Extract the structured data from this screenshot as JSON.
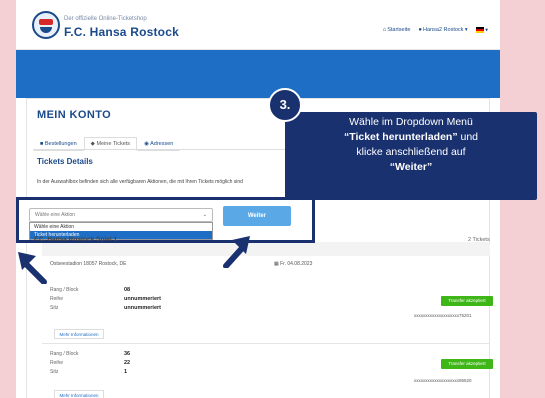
{
  "header": {
    "brand_sub": "Der offizielle Online-Ticketshop",
    "brand_main": "F.C. Hansa Rostock",
    "nav_home": "Startseite",
    "nav_user": "Hansa2 Rostock ▾",
    "nav_lang": "▾"
  },
  "account": {
    "title": "MEIN KONTO",
    "tabs": [
      {
        "label": "Bestellungen"
      },
      {
        "label": "Meine Tickets"
      },
      {
        "label": "Adressen"
      }
    ],
    "tickets_heading": "Tickets Details",
    "intro": "In der Auswahlbox befinden sich alle verfügbaren Aktionen, die mit Ihren Tickets möglich sind"
  },
  "dropdown": {
    "placeholder": "Wähle eine Aktion",
    "options": [
      "Wähle eine Aktion",
      "Ticket herunterladen"
    ],
    "selected": "Ticket herunterladen",
    "button": "Weiter"
  },
  "event": {
    "name": "F.C. Hansa Rostock Spiel 1",
    "ticket_count": "2 Tickets",
    "venue": "Ostseestadion 18057 Rostock, DE",
    "date": "Fr. 04.08.2023"
  },
  "tickets": [
    {
      "labels": [
        "Rang / Block",
        "Reihe",
        "Sitz"
      ],
      "values": [
        "08",
        "unnummeriert",
        "unnummeriert"
      ],
      "transfer": "Transfer akzeptiert",
      "barcode": "xxxxxxxxxxxxxxxxxxxx75201",
      "more": "Mehr Informationen"
    },
    {
      "labels": [
        "Rang / Block",
        "Reihe",
        "Sitz"
      ],
      "values": [
        "36",
        "22",
        "1"
      ],
      "transfer": "Transfer akzeptiert",
      "barcode": "xxxxxxxxxxxxxxxxxxxx95520",
      "more": "Mehr Informationen"
    }
  ],
  "callout": {
    "step": "3.",
    "line1": "Wähle im Dropdown Menü",
    "line2_bold": "“Ticket herunterladen”",
    "line2_rest": " und",
    "line3": "klicke anschließend auf",
    "line4_bold": "“Weiter”"
  },
  "colors": {
    "accent": "#1a3170",
    "header_blue": "#1e6ec6",
    "success": "#3fb618"
  }
}
